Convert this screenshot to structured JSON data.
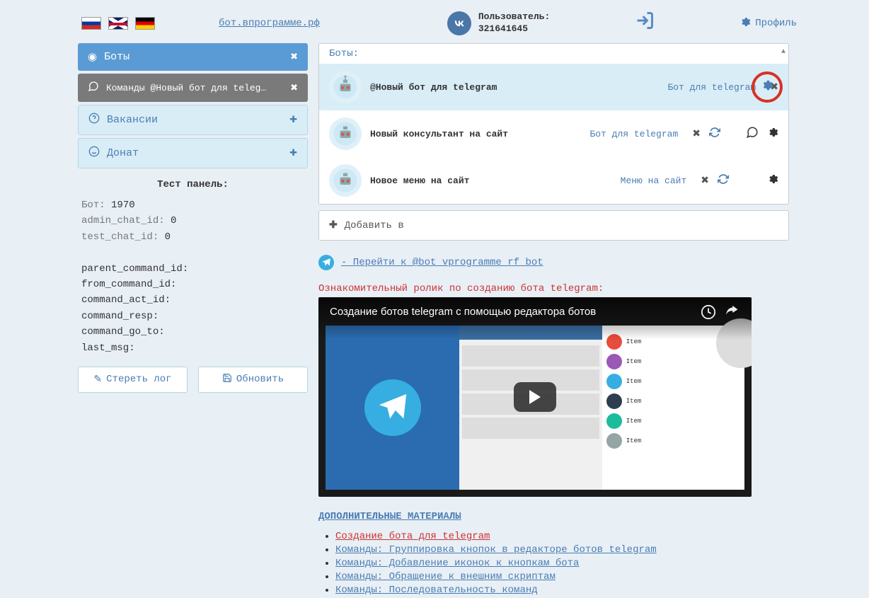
{
  "header": {
    "site_link": "бот.впрограмме.рф",
    "user_label": "Пользователь:",
    "user_id": "321641645",
    "profile_label": "Профиль"
  },
  "sidebar": {
    "items": [
      {
        "label": "Боты",
        "icon": "target-icon",
        "action_icon": "close-icon"
      },
      {
        "label": "Команды @Новый бот для teleg…",
        "icon": "chat-icon",
        "action_icon": "close-icon"
      },
      {
        "label": "Вакансии",
        "icon": "question-icon",
        "action_icon": "plus-icon"
      },
      {
        "label": "Донат",
        "icon": "smile-icon",
        "action_icon": "plus-icon"
      }
    ],
    "test_panel_title": "Тест панель:",
    "test_fields": {
      "bot_label": "Бот:",
      "bot_value": "1970",
      "admin_chat_label": "admin_chat_id:",
      "admin_chat_value": "0",
      "test_chat_label": "test_chat_id:",
      "test_chat_value": "0",
      "parent_cmd": "parent_command_id:",
      "from_cmd": "from_command_id:",
      "cmd_act": "command_act_id:",
      "cmd_resp": "command_resp:",
      "cmd_goto": "command_go_to:",
      "last_msg": "last_msg:"
    },
    "buttons": {
      "clear_log": "Стереть лог",
      "refresh": "Обновить"
    }
  },
  "bots_panel": {
    "title": "Боты:",
    "rows": [
      {
        "name": "@Новый бот для telegram",
        "type": "Бот для telegram",
        "highlighted": true,
        "circled_gear": true
      },
      {
        "name": "Новый консультант на сайт",
        "type": "Бот для telegram",
        "highlighted": false,
        "chat": true,
        "refresh": true
      },
      {
        "name": "Новое меню на сайт",
        "type": "Меню на сайт",
        "highlighted": false,
        "refresh": true
      }
    ],
    "add_label": "Добавить в"
  },
  "main": {
    "tg_link": " - Перейти к @bot_vprogramme_rf_bot",
    "video_section_title": "Ознакомительный ролик по созданию бота telegram:",
    "video_title": "Создание ботов telegram с помощью редактора ботов",
    "materials_title": "ДОПОЛНИТЕЛЬНЫЕ МАТЕРИАЛЫ",
    "materials": [
      {
        "text": "Создание бота для telegram",
        "cls": "mat-red"
      },
      {
        "text": "Команды: Группировка кнопок в редакторе ботов telegram",
        "cls": "mat-blue"
      },
      {
        "text": "Команды: Добавление иконок к кнопкам бота",
        "cls": "mat-blue"
      },
      {
        "text": "Команды: Обращение к внешним скриптам",
        "cls": "mat-blue"
      },
      {
        "text": "Команды: Последовательность команд",
        "cls": "mat-blue"
      }
    ]
  }
}
